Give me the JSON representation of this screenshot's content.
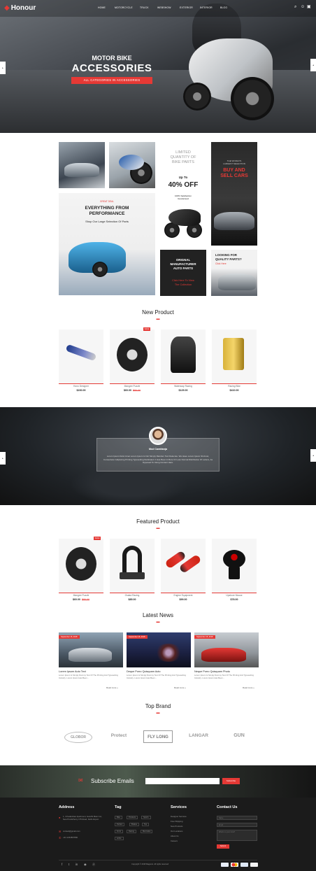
{
  "header": {
    "logo": "Honour",
    "nav": [
      "HOME",
      "MOTORCYCLE",
      "TRUCK",
      "WEBSHOW",
      "EXTERIOR",
      "INTERIOR",
      "BLOG"
    ]
  },
  "hero": {
    "subtitle": "MOTOR BIKE",
    "title": "ACCESSORIES",
    "button": "ALL CATEGORIES IN ACCESSORIES"
  },
  "promos": {
    "limited": {
      "line1": "LIMITED",
      "line2": "QUANTITY OF",
      "line3": "BIKE PARTS",
      "upto": "Up To",
      "offer": "40% OFF",
      "note1": "100% Satisfaction",
      "note2": "Guaranteed"
    },
    "buy": {
      "small1": "THE WORLD'S",
      "small2": "LARGEST SELECTION",
      "line1": "BUY AND",
      "line2": "SELL CARS"
    },
    "performance": {
      "badge": "GREAT DEAL",
      "line1": "EVERYTHING FROM",
      "line2": "PERFORMANCE",
      "sub": "Shop Our Large Selection Of Parts"
    },
    "original": {
      "line1": "ORIGNAL",
      "line2": "MANUFACTURER",
      "line3": "AUTO PARTS",
      "link1": "Click Here To View",
      "link2": "The Collection"
    },
    "quality": {
      "line1": "LOOKING FOR",
      "line2": "QUALITY PARTS?",
      "link": "Click Here"
    }
  },
  "new_product": {
    "title": "New Product",
    "items": [
      {
        "name": "Hono Designer",
        "price": "$230.00",
        "old": ""
      },
      {
        "name": "Mangee Puzzle",
        "price": "$60.00",
        "old": "$80.00",
        "badge": "SALE"
      },
      {
        "name": "Waterway Racing",
        "price": "$125.00",
        "old": ""
      },
      {
        "name": "Racing Bike",
        "price": "$410.00",
        "old": ""
      }
    ]
  },
  "testimonial": {
    "name": "Mod Carattanja",
    "text": "Lorem Ipsum Dolor Amet Lorem Ipsum Is Not Simply Random Text Delecute. We Have Lorem Ipsum Sit Amet, Consectetur Adipiscing Printing Typesetting Dedicated. It Has Been A More Or Less Normal Distribution Of Letters, As Opposed To Using Content Here."
  },
  "featured_product": {
    "title": "Featured Product",
    "items": [
      {
        "name": "Mangee Puzzle",
        "price": "$60.00",
        "old": "$80.00",
        "badge": "SALE"
      },
      {
        "name": "Osaka Racing",
        "price": "$85.00",
        "old": ""
      },
      {
        "name": "Engine Equipment",
        "price": "$99.00",
        "old": ""
      },
      {
        "name": "Upshore Mouse",
        "price": "$78.00",
        "old": ""
      }
    ]
  },
  "latest_news": {
    "title": "Latest News",
    "items": [
      {
        "date": "September 15, 2018",
        "title": "Lorem Ipsum Auto Text",
        "text": "Lorem Ipsum Is Simply Dummy Text Of The Printing And Typesetting Industry. Lorem Ipsum Has Been…",
        "more": "Read more »"
      },
      {
        "date": "September 15, 2018",
        "title": "Deque Porro Quisquam Auto",
        "text": "Lorem Ipsum Is Simply Dummy Text Of The Printing And Typesetting Industry. Lorem Ipsum Has Been…",
        "more": "Read more »"
      },
      {
        "date": "September 15, 2018",
        "title": "Neque Porro Quisquam Photo",
        "text": "Lorem Ipsum Is Simply Dummy Text Of The Printing And Typesetting Industry. Lorem Ipsum Has Been…",
        "more": "Read more »"
      }
    ]
  },
  "brands": {
    "title": "Top Brand",
    "items": [
      "GLOBOR",
      "Protect",
      "FLY LONG",
      "LANGAR",
      "GUN"
    ]
  },
  "subscribe": {
    "title": "Subscribe Emails",
    "button": "Subscribe"
  },
  "footer": {
    "address": {
      "title": "Address",
      "line1": "1, 4 Kadamban Apartment, Gandhi Main Cor, New Pondicherry 175 Road, Delhi Airport.",
      "email": "contact@gmail.com",
      "phone": "+91 1234567890"
    },
    "tags": {
      "title": "Tag",
      "items": [
        "Bike",
        "Products",
        "Sports",
        "Perfect",
        "Brakes",
        "Top",
        "Front",
        "Racing",
        "Mercedes",
        "entire"
      ]
    },
    "services": {
      "title": "Services",
      "items": [
        "Designer Services",
        "Free Shipping",
        "New Products",
        "Our Locations",
        "About Us",
        "Careers"
      ]
    },
    "contact": {
      "title": "Contact Us",
      "name_ph": "Name",
      "email_ph": "Email",
      "msg_ph": "What's on your mind?",
      "submit": "Submit"
    },
    "copyright": "Copyright © 2018 Magento. All rights reserved"
  },
  "colors": {
    "accent": "#e53935",
    "dark": "#1b1b1b"
  }
}
